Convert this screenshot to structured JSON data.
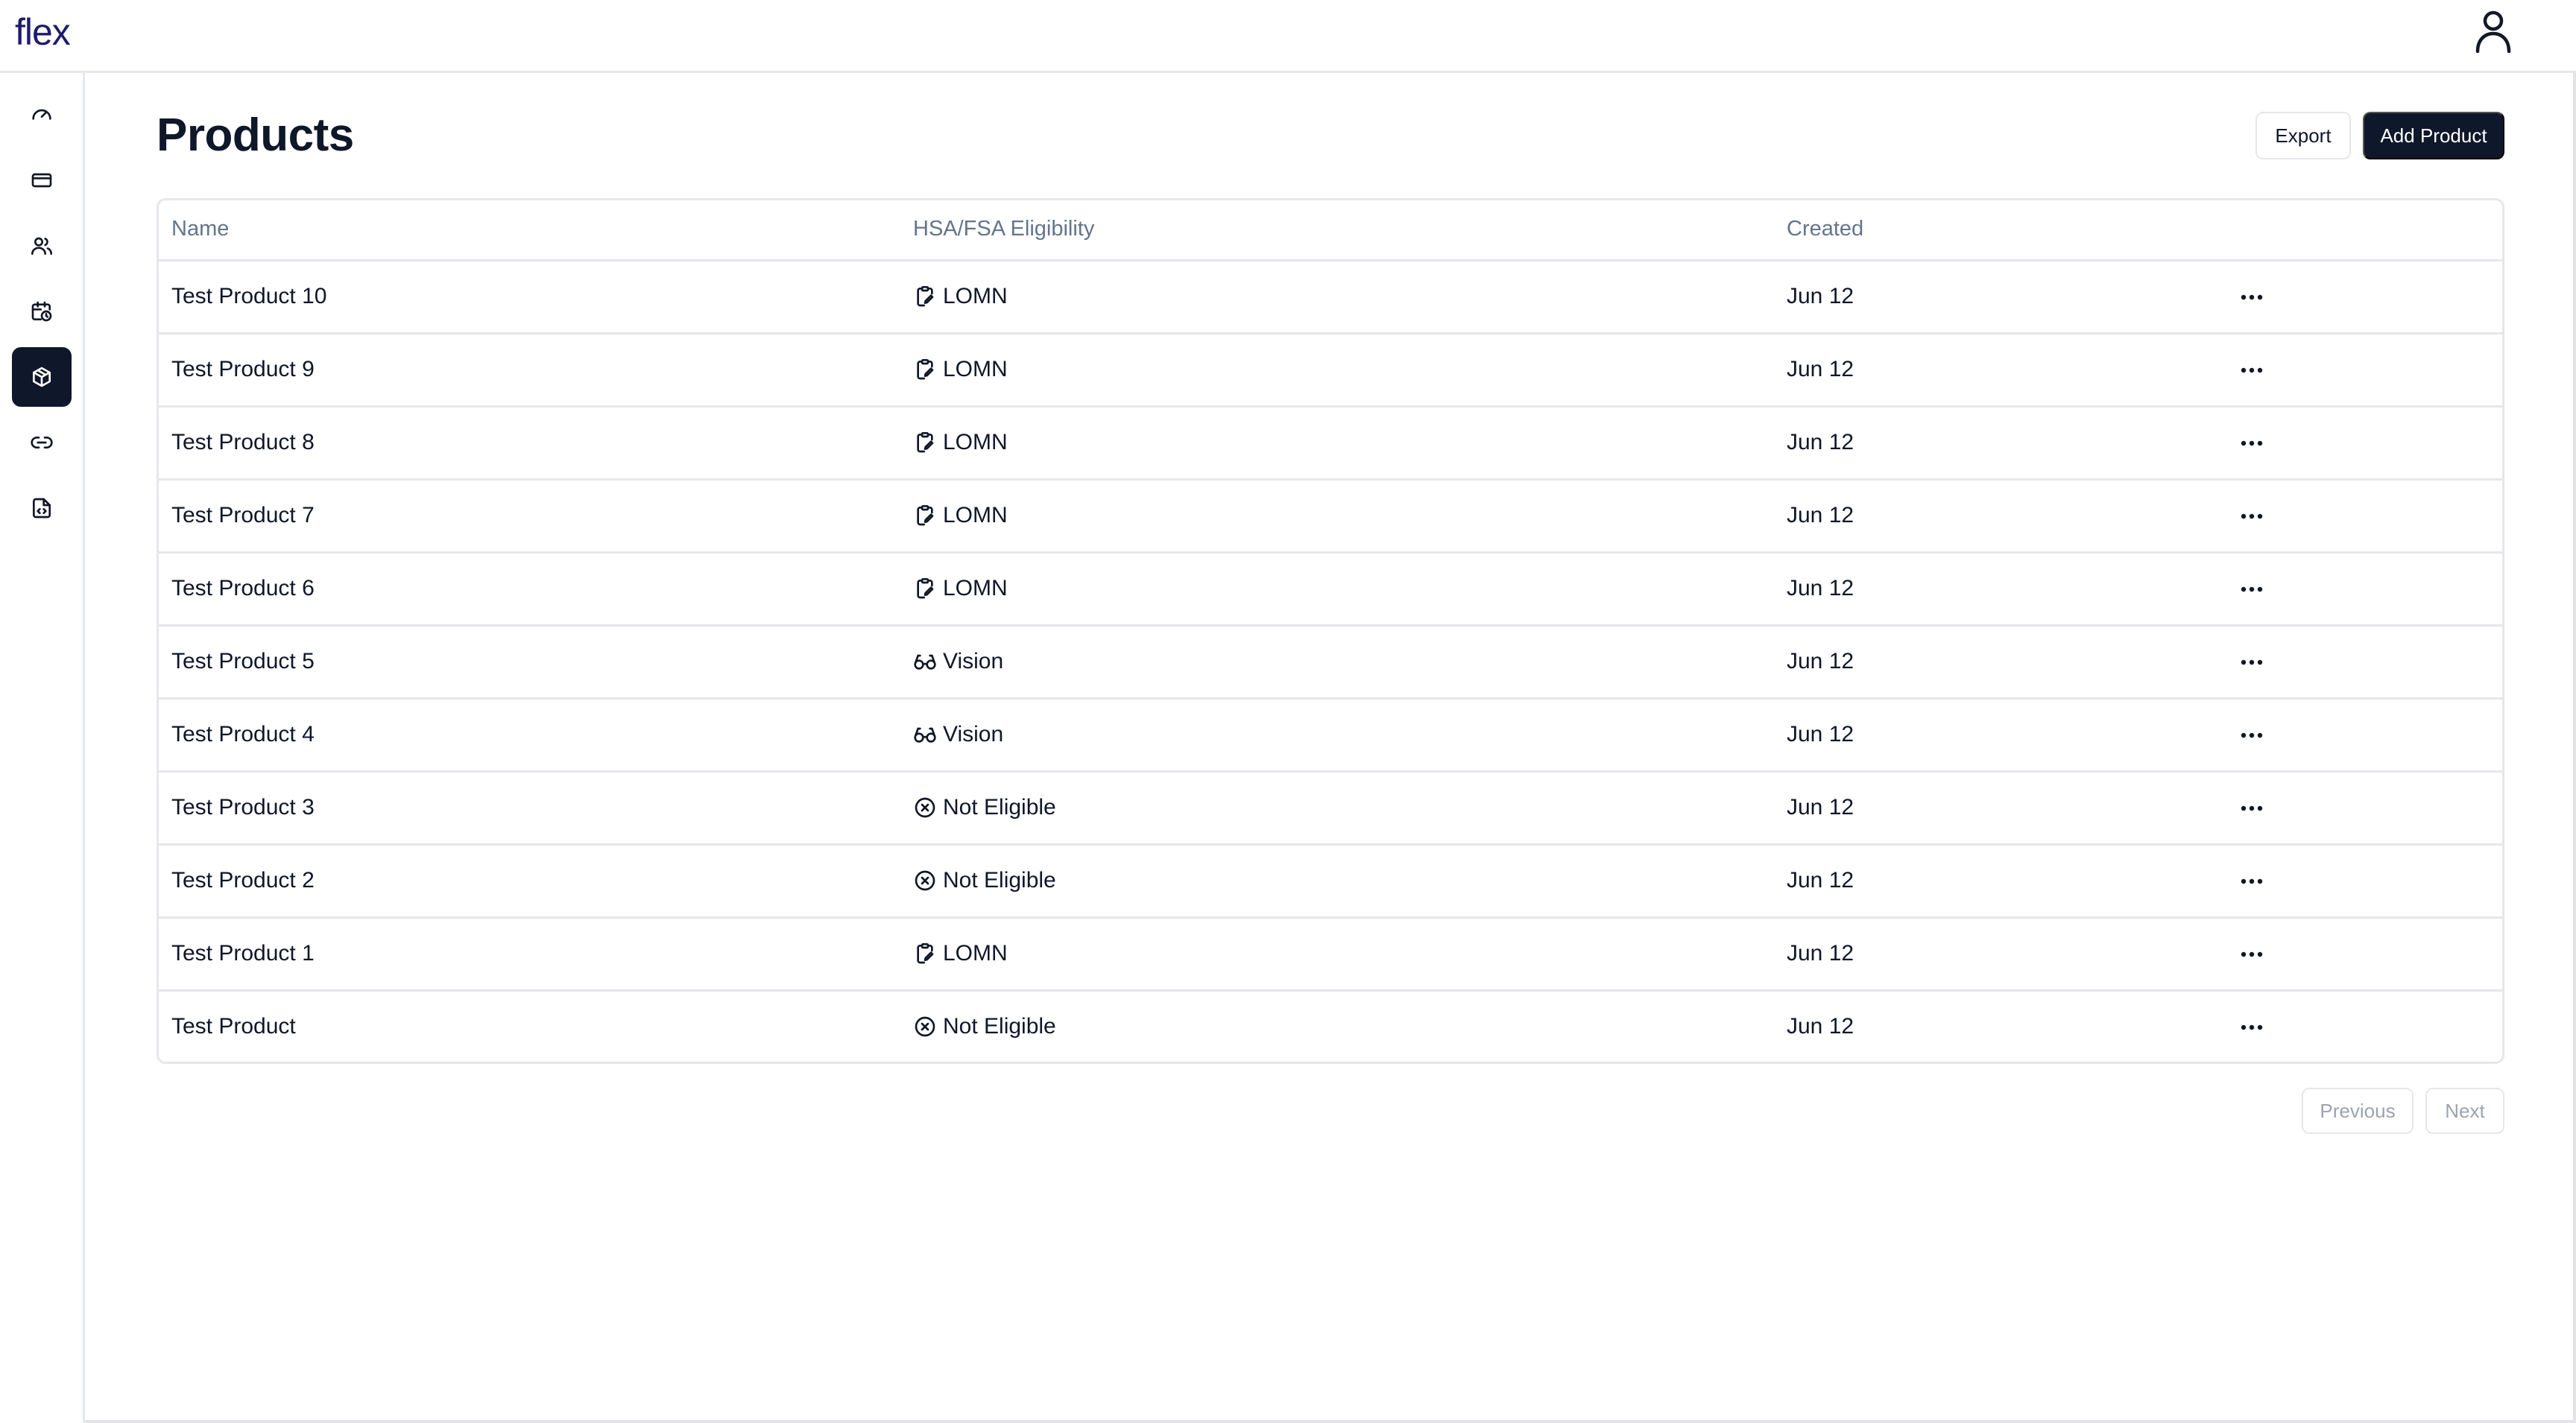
{
  "app": {
    "logo": "flex"
  },
  "sidebar": {
    "items": [
      {
        "name": "sidebar-item-dashboard",
        "icon": "gauge-icon",
        "active": false
      },
      {
        "name": "sidebar-item-payments",
        "icon": "credit-card-icon",
        "active": false
      },
      {
        "name": "sidebar-item-customers",
        "icon": "users-icon",
        "active": false
      },
      {
        "name": "sidebar-item-subscriptions",
        "icon": "calendar-clock-icon",
        "active": false
      },
      {
        "name": "sidebar-item-products",
        "icon": "package-icon",
        "active": true
      },
      {
        "name": "sidebar-item-links",
        "icon": "link-icon",
        "active": false
      },
      {
        "name": "sidebar-item-developers",
        "icon": "file-code-icon",
        "active": false
      }
    ]
  },
  "page": {
    "title": "Products",
    "export_label": "Export",
    "add_label": "Add Product"
  },
  "table": {
    "headers": {
      "name": "Name",
      "eligibility": "HSA/FSA Eligibility",
      "created": "Created"
    },
    "rows": [
      {
        "name": "Test Product 10",
        "eligibility": "LOMN",
        "icon": "clipboard-edit-icon",
        "created": "Jun 12"
      },
      {
        "name": "Test Product 9",
        "eligibility": "LOMN",
        "icon": "clipboard-edit-icon",
        "created": "Jun 12"
      },
      {
        "name": "Test Product 8",
        "eligibility": "LOMN",
        "icon": "clipboard-edit-icon",
        "created": "Jun 12"
      },
      {
        "name": "Test Product 7",
        "eligibility": "LOMN",
        "icon": "clipboard-edit-icon",
        "created": "Jun 12"
      },
      {
        "name": "Test Product 6",
        "eligibility": "LOMN",
        "icon": "clipboard-edit-icon",
        "created": "Jun 12"
      },
      {
        "name": "Test Product 5",
        "eligibility": "Vision",
        "icon": "glasses-icon",
        "created": "Jun 12"
      },
      {
        "name": "Test Product 4",
        "eligibility": "Vision",
        "icon": "glasses-icon",
        "created": "Jun 12"
      },
      {
        "name": "Test Product 3",
        "eligibility": "Not Eligible",
        "icon": "x-circle-icon",
        "created": "Jun 12"
      },
      {
        "name": "Test Product 2",
        "eligibility": "Not Eligible",
        "icon": "x-circle-icon",
        "created": "Jun 12"
      },
      {
        "name": "Test Product 1",
        "eligibility": "LOMN",
        "icon": "clipboard-edit-icon",
        "created": "Jun 12"
      },
      {
        "name": "Test Product",
        "eligibility": "Not Eligible",
        "icon": "x-circle-icon",
        "created": "Jun 12"
      }
    ]
  },
  "pagination": {
    "previous_label": "Previous",
    "next_label": "Next"
  }
}
